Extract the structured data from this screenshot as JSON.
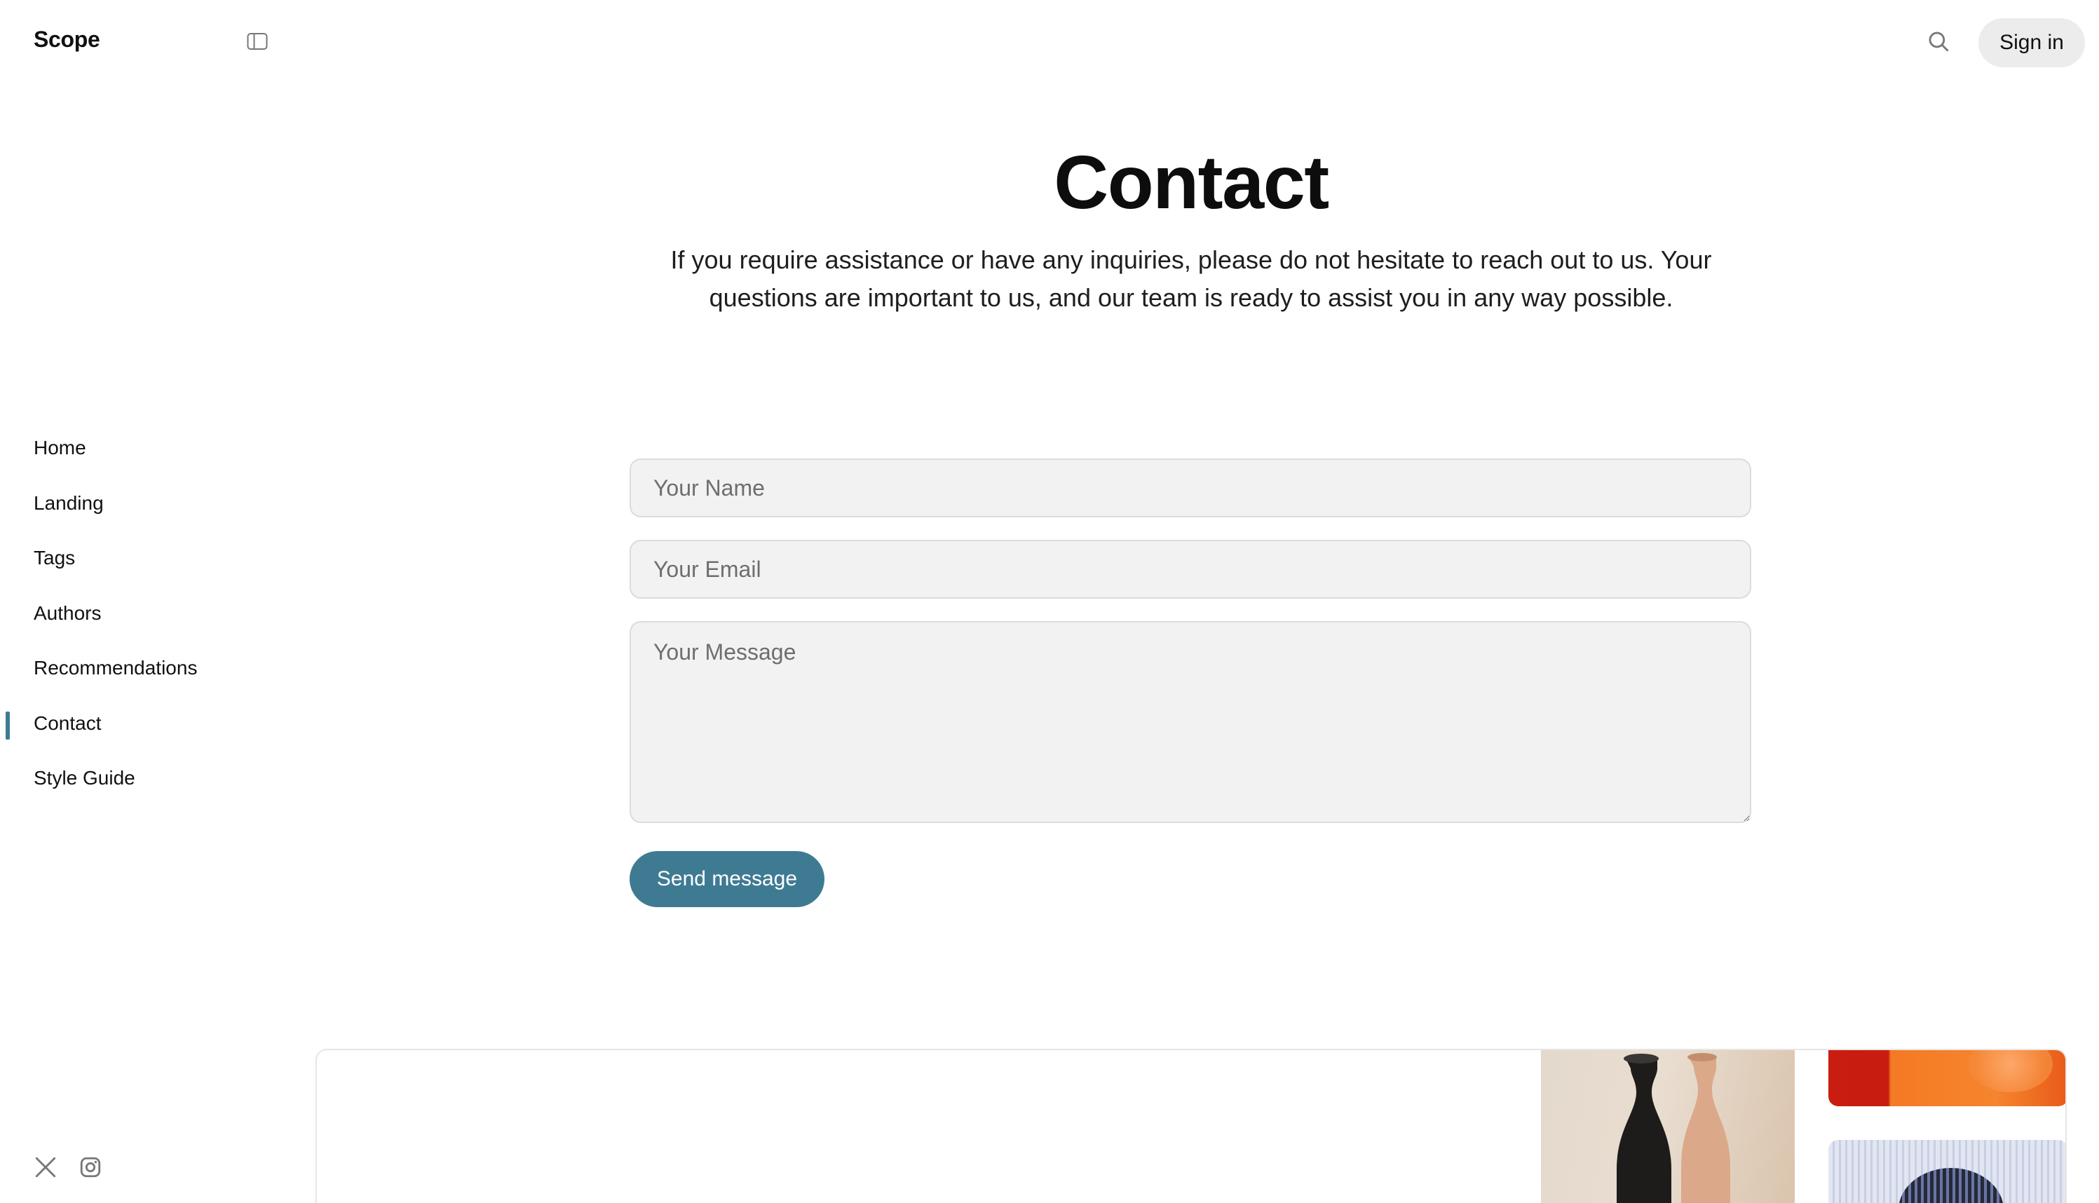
{
  "header": {
    "brand": "Scope",
    "signin_label": "Sign in"
  },
  "sidebar": {
    "items": [
      {
        "label": "Home"
      },
      {
        "label": "Landing"
      },
      {
        "label": "Tags"
      },
      {
        "label": "Authors"
      },
      {
        "label": "Recommendations"
      },
      {
        "label": "Contact",
        "active": true
      },
      {
        "label": "Style Guide"
      }
    ],
    "social": [
      "x-icon",
      "instagram-icon"
    ]
  },
  "main": {
    "title": "Contact",
    "intro": "If you require assistance or have any inquiries, please do not hesitate to reach out to us. Your questions are important to us, and our team is ready to assist you in any way possible.",
    "form": {
      "name_placeholder": "Your Name",
      "email_placeholder": "Your Email",
      "message_placeholder": "Your Message",
      "submit_label": "Send message"
    }
  },
  "colors": {
    "accent": "#3f7a93",
    "field_bg": "#f2f2f2",
    "signin_bg": "#ececec"
  }
}
